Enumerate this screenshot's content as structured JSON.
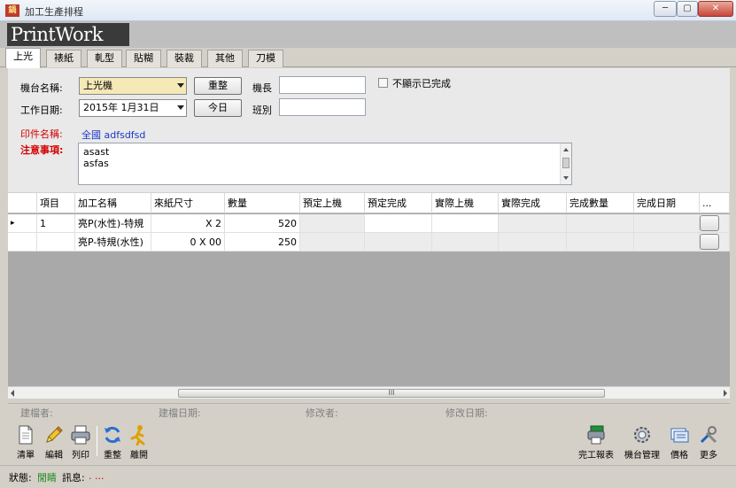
{
  "window": {
    "title": "加工生產排程",
    "app_icon": "鍋",
    "min_label": "─",
    "max_label": "▢",
    "close_label": "✕"
  },
  "logo": "PrintWork",
  "tabs": [
    "上光",
    "裱紙",
    "軋型",
    "貼糊",
    "裝裁",
    "其他",
    "刀模"
  ],
  "form": {
    "machine_label": "機台名稱:",
    "machine_value": "上光機",
    "reset_button": "重整",
    "leader_label": "機長",
    "hide_done_label": "不顯示已完成",
    "date_label": "工作日期:",
    "date_value": "2015年 1月31日",
    "today_button": "今日",
    "shift_label": "班別",
    "job_name_label": "印件名稱:",
    "job_name_link": "全國 adfsdfsd",
    "notes_label": "注意事項:",
    "notes": [
      "asast",
      "asfas"
    ]
  },
  "grid": {
    "columns": [
      "項目",
      "加工名稱",
      "來紙尺寸",
      "數量",
      "預定上機",
      "預定完成",
      "實際上機",
      "實際完成",
      "完成數量",
      "完成日期",
      "..."
    ],
    "rows": [
      {
        "marker": "▸",
        "item": "1",
        "name": "亮P(水性)-特規",
        "size": "X 2",
        "qty": "520"
      },
      {
        "marker": "",
        "item": "",
        "name": "亮P-特規(水性)",
        "size": "0 X 00",
        "qty": "250"
      }
    ],
    "scroll_grip": "III"
  },
  "audit": {
    "creator_label": "建檔者:",
    "created_date_label": "建檔日期:",
    "modifier_label": "修改者:",
    "modified_date_label": "修改日期:"
  },
  "toolbar": {
    "left": [
      {
        "label": "清單",
        "icon": "document-icon"
      },
      {
        "label": "編輯",
        "icon": "pencil-icon"
      },
      {
        "label": "列印",
        "icon": "printer-icon"
      },
      {
        "label": "重整",
        "icon": "refresh-icon"
      },
      {
        "label": "離開",
        "icon": "exit-icon"
      }
    ],
    "right": [
      {
        "label": "完工報表",
        "icon": "report-icon"
      },
      {
        "label": "機台管理",
        "icon": "machine-gear-icon"
      },
      {
        "label": "價格",
        "icon": "price-icon"
      },
      {
        "label": "更多",
        "icon": "tools-icon"
      }
    ]
  },
  "status": {
    "state_label": "狀態:",
    "state_value": "閒睛",
    "message_label": "訊息:",
    "message_value": ". ..."
  },
  "colors": {
    "accent_red": "#d40000",
    "link_blue": "#1a36c8",
    "status_green": "#1f8a1f",
    "machine_highlight": "#f5e9b8"
  }
}
